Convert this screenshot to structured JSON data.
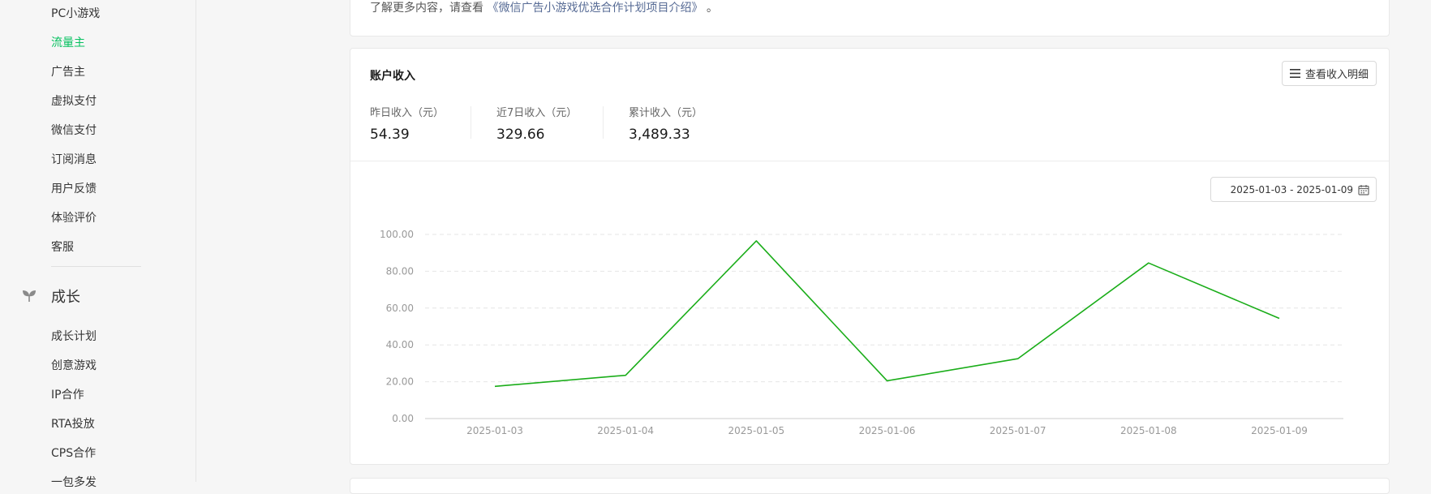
{
  "sidebar": {
    "items_top": [
      {
        "label": "PC小游戏",
        "active": false
      },
      {
        "label": "流量主",
        "active": true
      },
      {
        "label": "广告主",
        "active": false
      },
      {
        "label": "虚拟支付",
        "active": false
      },
      {
        "label": "微信支付",
        "active": false
      },
      {
        "label": "订阅消息",
        "active": false
      },
      {
        "label": "用户反馈",
        "active": false
      },
      {
        "label": "体验评价",
        "active": false
      },
      {
        "label": "客服",
        "active": false
      }
    ],
    "section": {
      "label": "成长",
      "icon": "sprout-icon"
    },
    "items_bottom": [
      {
        "label": "成长计划"
      },
      {
        "label": "创意游戏"
      },
      {
        "label": "IP合作"
      },
      {
        "label": "RTA投放"
      },
      {
        "label": "CPS合作"
      },
      {
        "label": "一包多发"
      }
    ],
    "active_color": "#07c160"
  },
  "intro": {
    "prefix": "了解更多内容，请查看",
    "link": "《微信广告小游戏优选合作计划项目介绍》",
    "suffix": "。"
  },
  "income": {
    "title": "账户收入",
    "detail_button": "查看收入明细",
    "stats": [
      {
        "label": "昨日收入（元）",
        "value": "54.39"
      },
      {
        "label": "近7日收入（元）",
        "value": "329.66"
      },
      {
        "label": "累计收入（元）",
        "value": "3,489.33"
      }
    ],
    "date_range": "2025-01-03 - 2025-01-09"
  },
  "chart_data": {
    "type": "line",
    "x": [
      "2025-01-03",
      "2025-01-04",
      "2025-01-05",
      "2025-01-06",
      "2025-01-07",
      "2025-01-08",
      "2025-01-09"
    ],
    "series": [
      {
        "values": [
          17.5,
          23.5,
          96.5,
          20.5,
          32.5,
          84.5,
          54.39
        ],
        "color": "#1aad19"
      }
    ],
    "yticks": [
      "0.00",
      "20.00",
      "40.00",
      "60.00",
      "80.00",
      "100.00"
    ],
    "ylim": [
      0,
      100
    ],
    "grid": true,
    "title": "",
    "xlabel": "",
    "ylabel": ""
  }
}
